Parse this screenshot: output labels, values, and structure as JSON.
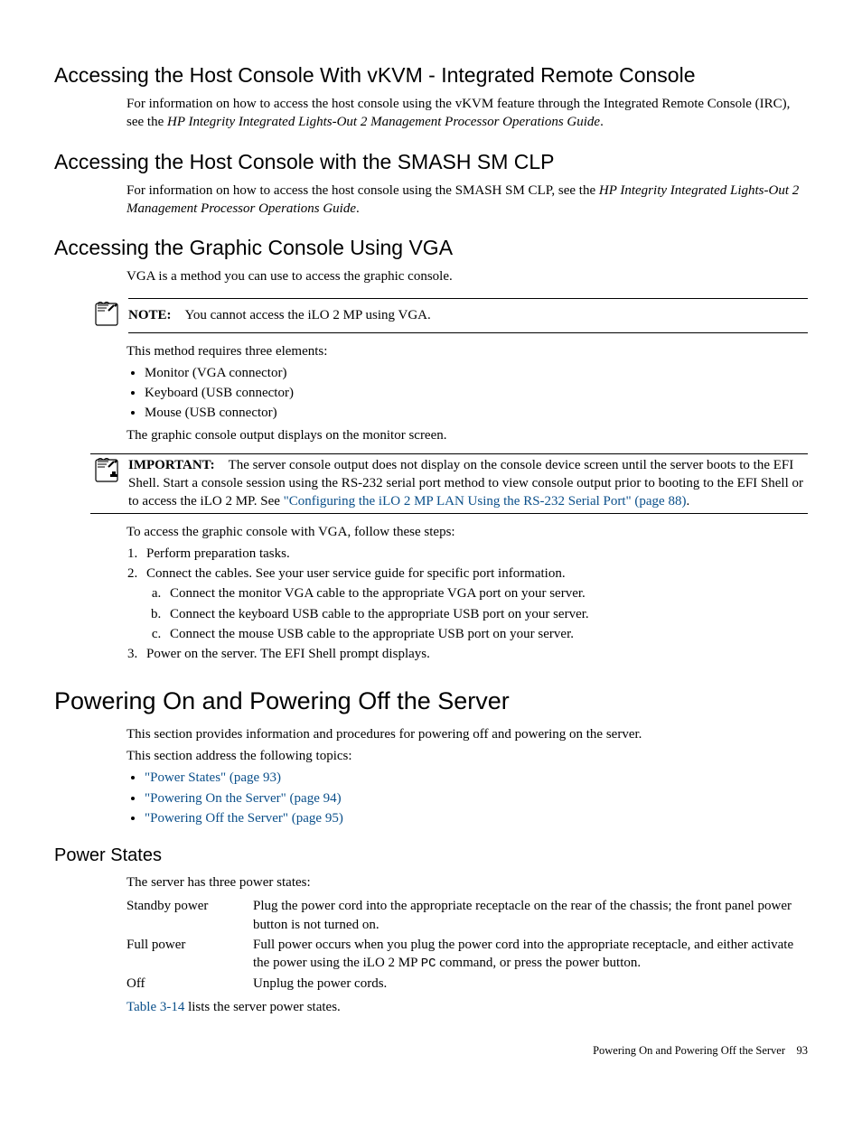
{
  "sections": {
    "vkvm": {
      "heading": "Accessing the Host Console With vKVM - Integrated Remote Console",
      "para_pre": "For information on how to access the host console using the vKVM feature through the Integrated Remote Console (IRC), see the ",
      "para_italic": "HP Integrity Integrated Lights-Out 2 Management Processor Operations Guide",
      "para_post": "."
    },
    "smash": {
      "heading": "Accessing the Host Console with the SMASH SM CLP",
      "para_pre": "For information on how to access the host console using the SMASH SM CLP, see the ",
      "para_italic": "HP Integrity Integrated Lights-Out 2 Management Processor Operations Guide",
      "para_post": "."
    },
    "vga": {
      "heading": "Accessing the Graphic Console Using VGA",
      "intro": "VGA is a method you can use to access the graphic console.",
      "note_label": "NOTE:",
      "note_text": "You cannot access the iLO 2 MP using VGA.",
      "after_note": "This method requires three elements:",
      "bullets": [
        "Monitor (VGA connector)",
        "Keyboard (USB connector)",
        "Mouse (USB connector)"
      ],
      "after_bullets": "The graphic console output displays on the monitor screen.",
      "important_label": "IMPORTANT:",
      "important_text_pre": "The server console output does not display on the console device screen until the server boots to the EFI Shell. Start a console session using the RS-232 serial port method to view console output prior to booting to the EFI Shell or to access the iLO 2 MP. See ",
      "important_link": "\"Configuring the iLO 2 MP LAN Using the RS-232 Serial Port\" (page 88)",
      "important_text_post": ".",
      "steps_intro": "To access the graphic console with VGA, follow these steps:",
      "steps": [
        "Perform preparation tasks.",
        "Connect the cables. See your user service guide for specific port information.",
        "Power on the server. The EFI Shell prompt displays."
      ],
      "substeps": [
        "Connect the monitor VGA cable to the appropriate VGA port on your server.",
        "Connect the keyboard USB cable to the appropriate USB port on your server.",
        "Connect the mouse USB cable to the appropriate USB port on your server."
      ]
    },
    "power": {
      "heading": "Powering On and Powering Off the Server",
      "intro1": "This section provides information and procedures for powering off and powering on the server.",
      "intro2": "This section address the following topics:",
      "links": [
        "\"Power States\" (page 93)",
        "\"Powering On the Server\" (page 94)",
        "\"Powering Off the Server\" (page 95)"
      ]
    },
    "states": {
      "heading": "Power States",
      "intro": "The server has three power states:",
      "rows": [
        {
          "term": "Standby power",
          "def": "Plug the power cord into the appropriate receptacle on the rear of the chassis; the front panel power button is not turned on."
        },
        {
          "term": "Full power",
          "def_pre": "Full power occurs when you plug the power cord into the appropriate receptacle, and either activate the power using the iLO 2 MP ",
          "def_mono": "PC",
          "def_post": " command, or press the power button."
        },
        {
          "term": "Off",
          "def": "Unplug the power cords."
        }
      ],
      "table_link": "Table 3-14",
      "table_post": " lists the server power states."
    }
  },
  "footer": {
    "text": "Powering On and Powering Off the Server",
    "page": "93"
  }
}
